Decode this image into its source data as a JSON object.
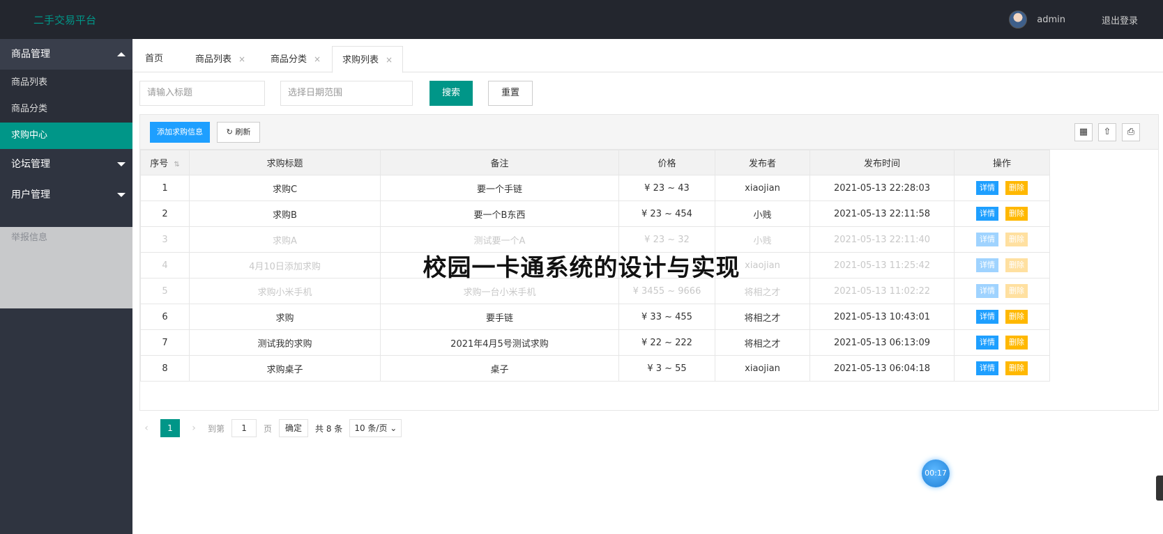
{
  "app": {
    "logo": "二手交易平台"
  },
  "header": {
    "username": "admin",
    "logout": "退出登录"
  },
  "sidebar": {
    "groups": [
      {
        "label": "商品管理",
        "expanded": true
      },
      {
        "label": "论坛管理",
        "expanded": false
      },
      {
        "label": "用户管理",
        "expanded": false
      }
    ],
    "sub_items": [
      "商品列表",
      "商品分类",
      "求购中心"
    ],
    "faded_item": "举报信息"
  },
  "tabs": [
    {
      "label": "首页",
      "closable": false
    },
    {
      "label": "商品列表",
      "closable": true
    },
    {
      "label": "商品分类",
      "closable": true
    },
    {
      "label": "求购列表",
      "closable": true,
      "active": true
    }
  ],
  "tab_close_glyph": "×",
  "search": {
    "title_placeholder": "请输入标题",
    "date_placeholder": "选择日期范围",
    "search_label": "搜索",
    "reset_label": "重置"
  },
  "toolbar": {
    "add_label": "添加求购信息",
    "refresh_label": "刷新"
  },
  "table": {
    "columns": [
      "序号",
      "求购标题",
      "备注",
      "价格",
      "发布者",
      "发布时间",
      "操作"
    ],
    "action_detail": "详情",
    "action_delete": "删除",
    "rows": [
      {
        "no": "1",
        "title": "求购C",
        "note": "要一个手链",
        "price": "¥ 23 ~ 43",
        "publisher": "xiaojian",
        "time": "2021-05-13 22:28:03"
      },
      {
        "no": "2",
        "title": "求购B",
        "note": "要一个B东西",
        "price": "¥ 23 ~ 454",
        "publisher": "小贱",
        "time": "2021-05-13 22:11:58"
      },
      {
        "no": "3",
        "title": "求购A",
        "note": "测试要一个A",
        "price": "¥ 23 ~ 32",
        "publisher": "小贱",
        "time": "2021-05-13 22:11:40"
      },
      {
        "no": "4",
        "title": "4月10日添加求购",
        "note": "",
        "price": "",
        "publisher": "xiaojian",
        "time": "2021-05-13 11:25:42"
      },
      {
        "no": "5",
        "title": "求购小米手机",
        "note": "求购一台小米手机",
        "price": "¥ 3455 ~ 9666",
        "publisher": "将相之才",
        "time": "2021-05-13 11:02:22"
      },
      {
        "no": "6",
        "title": "求购",
        "note": "要手链",
        "price": "¥ 33 ~ 455",
        "publisher": "将相之才",
        "time": "2021-05-13 10:43:01"
      },
      {
        "no": "7",
        "title": "测试我的求购",
        "note": "2021年4月5号测试求购",
        "price": "¥ 22 ~ 222",
        "publisher": "将相之才",
        "time": "2021-05-13 06:13:09"
      },
      {
        "no": "8",
        "title": "求购桌子",
        "note": "桌子",
        "price": "¥ 3 ~ 55",
        "publisher": "xiaojian",
        "time": "2021-05-13 06:04:18"
      }
    ]
  },
  "pager": {
    "current": "1",
    "goto_label": "到第",
    "goto_value": "1",
    "page_unit": "页",
    "confirm": "确定",
    "total": "共 8 条",
    "page_size": "10 条/页"
  },
  "overlay": {
    "watermark": "校园一卡通系统的设计与实现",
    "timer": "00:17"
  },
  "colors": {
    "primary": "#009688",
    "blue": "#1e9fff",
    "orange": "#ffb800",
    "header_bg": "#23262e",
    "sidebar_bg": "#2f3440"
  }
}
